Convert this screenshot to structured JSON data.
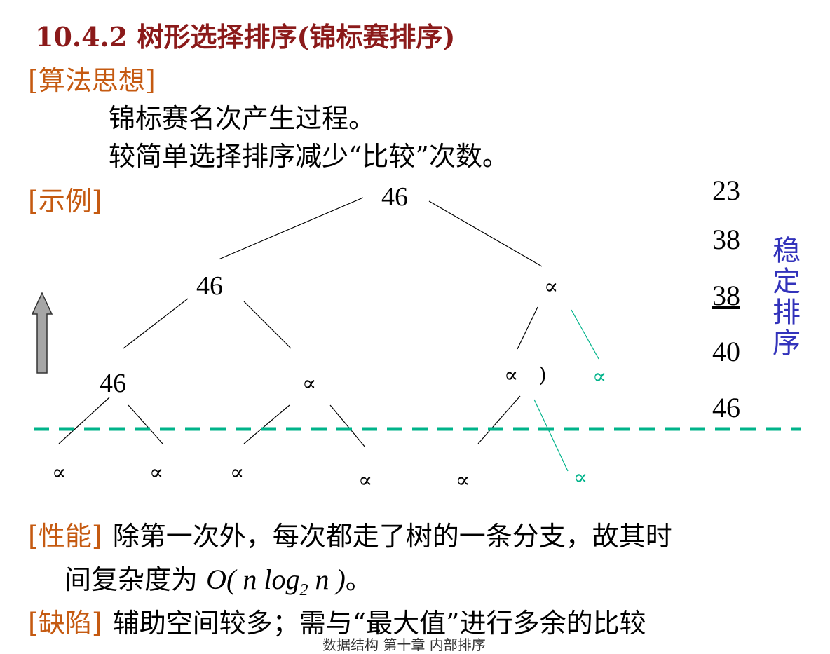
{
  "title": "10.4.2 树形选择排序(锦标赛排序)",
  "sections": {
    "idea": {
      "label": "[算法思想]",
      "lines": [
        "锦标赛名次产生过程。",
        "较简单选择排序减少“比较”次数。"
      ]
    },
    "example": {
      "label": "[示例]"
    },
    "performance": {
      "label": "[性能]",
      "line1": "除第一次外，每次都走了树的一条分支，故其时",
      "line2_prefix": "间复杂度为",
      "formula": {
        "O": "O(",
        "n": "n",
        "log": "log",
        "sub": "2",
        "n2": "n",
        "close": ")"
      },
      "line2_suffix": "。"
    },
    "defect": {
      "label": "[缺陷]",
      "text": "辅助空间较多；需与“最大值”进行多余的比较"
    }
  },
  "tree": {
    "root": "46",
    "level1": [
      "46",
      "∝"
    ],
    "level2": [
      "46",
      "∝",
      "∝",
      ")",
      "∝"
    ],
    "leaves": [
      "∝",
      "∝",
      "∝",
      "∝",
      "∝",
      "∝"
    ]
  },
  "sorted_output": [
    "23",
    "38",
    "38",
    "40",
    "46"
  ],
  "stable_label": [
    "稳",
    "定",
    "排",
    "序"
  ],
  "footer": "数据结构 第十章 内部排序",
  "colors": {
    "title": "#8b1a1a",
    "label": "#c55a11",
    "teal": "#00b38a",
    "stable": "#3333bb",
    "arrow": "#a6a6a6"
  }
}
